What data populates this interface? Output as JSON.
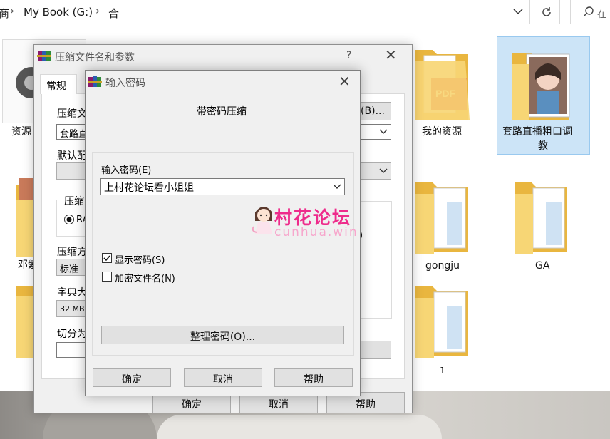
{
  "explorer": {
    "breadcrumb": {
      "partial_prefix": "商",
      "drive": "My Book (G:)",
      "folder": "合"
    },
    "search_partial": "在"
  },
  "folders": {
    "partial_left": [
      "资源",
      "邓紫"
    ],
    "pdf_folder": "我的资源",
    "photo_folder_line1": "套路直播粗口调",
    "photo_folder_line2": "教",
    "gongju": "gongju",
    "ga": "GA",
    "one": "1"
  },
  "archive_dialog": {
    "title": "压缩文件名和参数",
    "help_glyph": "?",
    "tab_general": "常规",
    "label_archive_name": "压缩文",
    "archive_name_value": "套路直",
    "browse_button": "(B)...",
    "label_default_profile": "默认配",
    "label_format": "压缩",
    "radio_rar": "RA",
    "label_method": "压缩方",
    "method_value": "标准",
    "label_dictionary": "字典大",
    "dictionary_value": "32 MB",
    "label_split": "切分为",
    "right_edge_char": ")",
    "ok": "确定",
    "cancel": "取消",
    "help": "帮助"
  },
  "password_dialog": {
    "title": "输入密码",
    "heading": "带密码压缩",
    "label_enter_password": "输入密码(E)",
    "password_value": "上村花论坛看小姐姐",
    "show_password": "显示密码(S)",
    "show_password_checked": true,
    "encrypt_filenames": "加密文件名(N)",
    "encrypt_filenames_checked": false,
    "organize_button": "整理密码(O)...",
    "ok": "确定",
    "cancel": "取消",
    "help": "帮助"
  },
  "watermark": {
    "brand": "村花论坛",
    "site": "cunhua.win"
  },
  "colors": {
    "folder_yellow": "#f7d675",
    "folder_dark": "#e9b63f",
    "selection": "#cce4f7",
    "watermark_pink": "#ee2b8b"
  },
  "icons": {
    "winrar": "winrar-books-icon",
    "search": "search-icon",
    "refresh": "refresh-icon",
    "close": "close-icon",
    "dropdown": "chevron-down-icon"
  }
}
